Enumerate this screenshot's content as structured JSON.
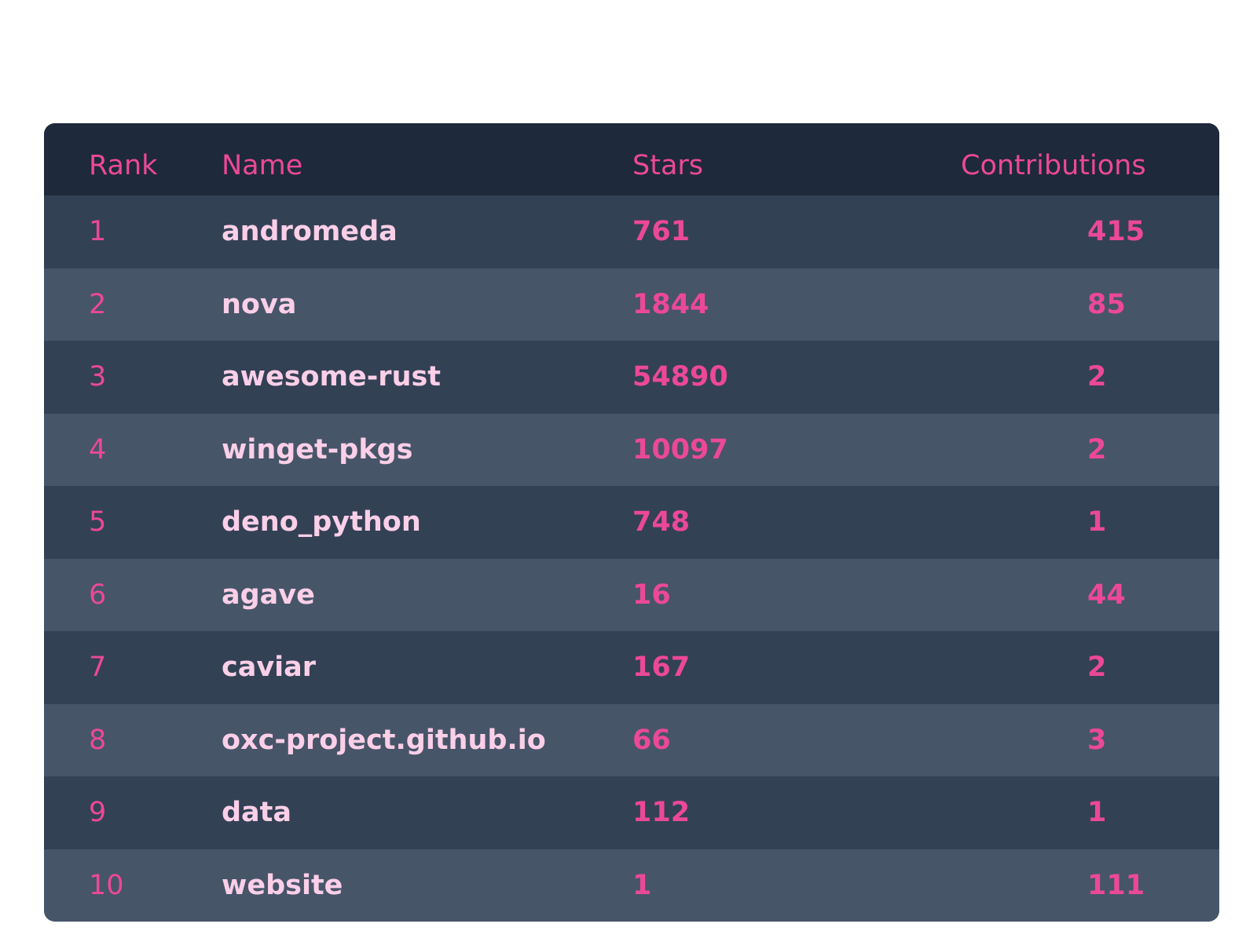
{
  "table": {
    "headers": {
      "rank": "Rank",
      "name": "Name",
      "stars": "Stars",
      "contributions": "Contributions"
    },
    "rows": [
      {
        "rank": "1",
        "name": "andromeda",
        "stars": "761",
        "contributions": "415"
      },
      {
        "rank": "2",
        "name": "nova",
        "stars": "1844",
        "contributions": "85"
      },
      {
        "rank": "3",
        "name": "awesome-rust",
        "stars": "54890",
        "contributions": "2"
      },
      {
        "rank": "4",
        "name": "winget-pkgs",
        "stars": "10097",
        "contributions": "2"
      },
      {
        "rank": "5",
        "name": "deno_python",
        "stars": "748",
        "contributions": "1"
      },
      {
        "rank": "6",
        "name": "agave",
        "stars": "16",
        "contributions": "44"
      },
      {
        "rank": "7",
        "name": "caviar",
        "stars": "167",
        "contributions": "2"
      },
      {
        "rank": "8",
        "name": "oxc-project.github.io",
        "stars": "66",
        "contributions": "3"
      },
      {
        "rank": "9",
        "name": "data",
        "stars": "112",
        "contributions": "1"
      },
      {
        "rank": "10",
        "name": "website",
        "stars": "1",
        "contributions": "111"
      }
    ]
  },
  "colors": {
    "header_bg": "#1e293b",
    "row_dark": "#334155",
    "row_light": "#475569",
    "accent": "#ec4899",
    "name_text": "#fbcfe8"
  }
}
